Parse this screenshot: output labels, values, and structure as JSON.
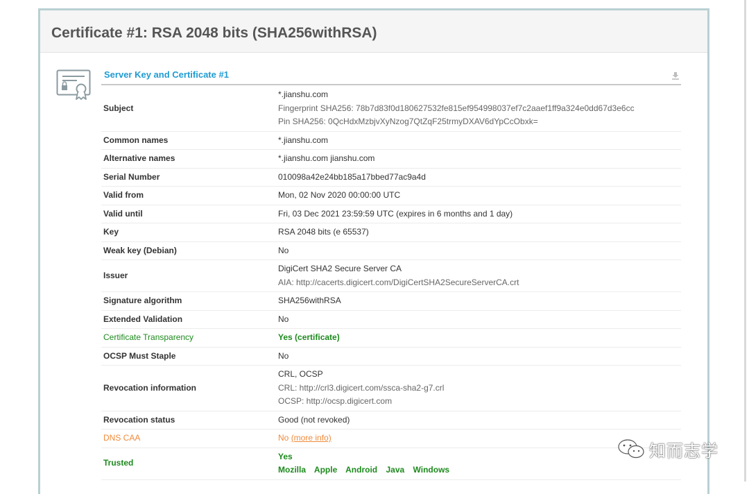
{
  "title": "Certificate #1: RSA 2048 bits (SHA256withRSA)",
  "section_title": "Server Key and Certificate #1",
  "icons": {
    "certificate": "certificate-icon",
    "download": "download-icon",
    "watermark_logo": "wechat-logo-icon"
  },
  "colors": {
    "accent_blue": "#1f9bd2",
    "good_green": "#1d8a1d",
    "warn_orange": "#f08a3a"
  },
  "rows": {
    "subject": {
      "label": "Subject",
      "line1": "*.jianshu.com",
      "line2": "Fingerprint SHA256: 78b7d83f0d180627532fe815ef954998037ef7c2aaef1ff9a324e0dd67d3e6cc",
      "line3": "Pin SHA256: 0QcHdxMzbjvXyNzog7QtZqF25trmyDXAV6dYpCcObxk="
    },
    "common_names": {
      "label": "Common names",
      "value": "*.jianshu.com"
    },
    "alt_names": {
      "label": "Alternative names",
      "value": "*.jianshu.com jianshu.com"
    },
    "serial": {
      "label": "Serial Number",
      "value": "010098a42e24bb185a17bbed77ac9a4d"
    },
    "valid_from": {
      "label": "Valid from",
      "value": "Mon, 02 Nov 2020 00:00:00 UTC"
    },
    "valid_until": {
      "label": "Valid until",
      "value": "Fri, 03 Dec 2021 23:59:59 UTC (expires in 6 months and 1 day)"
    },
    "key": {
      "label": "Key",
      "value": "RSA 2048 bits (e 65537)"
    },
    "weak_key": {
      "label": "Weak key (Debian)",
      "value": "No"
    },
    "issuer": {
      "label": "Issuer",
      "line1": "DigiCert SHA2 Secure Server CA",
      "line2": "AIA: http://cacerts.digicert.com/DigiCertSHA2SecureServerCA.crt"
    },
    "sig_alg": {
      "label": "Signature algorithm",
      "value": "SHA256withRSA"
    },
    "ev": {
      "label": "Extended Validation",
      "value": "No"
    },
    "ct": {
      "label": "Certificate Transparency",
      "value": "Yes (certificate)"
    },
    "ocsp_staple": {
      "label": "OCSP Must Staple",
      "value": "No"
    },
    "revocation_info": {
      "label": "Revocation information",
      "line1": "CRL, OCSP",
      "line2": "CRL: http://crl3.digicert.com/ssca-sha2-g7.crl",
      "line3": "OCSP: http://ocsp.digicert.com"
    },
    "revocation_status": {
      "label": "Revocation status",
      "value": "Good (not revoked)"
    },
    "dns_caa": {
      "label": "DNS CAA",
      "value": "No",
      "link": "(more info)"
    },
    "trusted": {
      "label": "Trusted",
      "value": "Yes",
      "stores": [
        "Mozilla",
        "Apple",
        "Android",
        "Java",
        "Windows"
      ]
    }
  },
  "watermark": {
    "text": "知而志学"
  }
}
